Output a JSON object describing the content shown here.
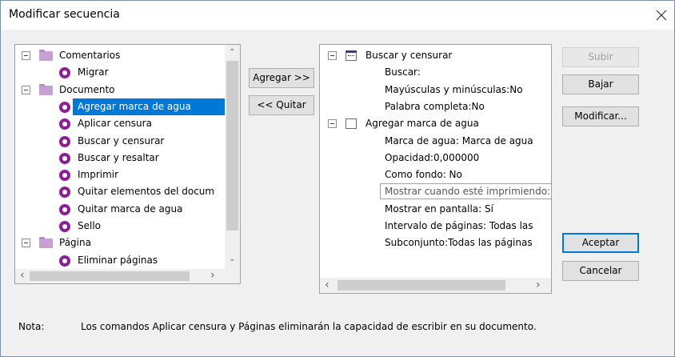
{
  "window": {
    "title": "Modificar secuencia"
  },
  "left_tree": [
    {
      "kind": "group",
      "label": "Comentarios"
    },
    {
      "kind": "item",
      "label": "Migrar"
    },
    {
      "kind": "group",
      "label": "Documento"
    },
    {
      "kind": "item",
      "label": "Agregar marca de agua",
      "selected": true
    },
    {
      "kind": "item",
      "label": "Aplicar censura"
    },
    {
      "kind": "item",
      "label": "Buscar y censurar"
    },
    {
      "kind": "item",
      "label": "Buscar y resaltar"
    },
    {
      "kind": "item",
      "label": "Imprimir"
    },
    {
      "kind": "item",
      "label": "Quitar elementos del docum"
    },
    {
      "kind": "item",
      "label": "Quitar marca de agua"
    },
    {
      "kind": "item",
      "label": "Sello"
    },
    {
      "kind": "group",
      "label": "Página"
    },
    {
      "kind": "item",
      "label": "Eliminar páginas"
    }
  ],
  "middle_buttons": {
    "add": "Agregar >>",
    "remove": "<< Quitar"
  },
  "right_tree": [
    {
      "kind": "group",
      "label": "Buscar y censurar",
      "icon": "dotted-rect-icon"
    },
    {
      "kind": "prop",
      "label": "Buscar:"
    },
    {
      "kind": "prop",
      "label": "Mayúsculas y minúsculas:No"
    },
    {
      "kind": "prop",
      "label": "Palabra completa:No"
    },
    {
      "kind": "group",
      "label": "Agregar marca de agua",
      "icon": "empty-rect-icon"
    },
    {
      "kind": "prop",
      "label": "Marca de agua: Marca de agua"
    },
    {
      "kind": "prop",
      "label": "Opacidad:0,000000"
    },
    {
      "kind": "prop",
      "label": "Como fondo: No"
    },
    {
      "kind": "prop",
      "label": "Mostrar cuando esté imprimiendo: Sí",
      "focused": true
    },
    {
      "kind": "prop",
      "label": "Mostrar en pantalla: Sí"
    },
    {
      "kind": "prop",
      "label": "Intervalo de páginas: Todas las"
    },
    {
      "kind": "prop",
      "label": "Subconjunto:Todas las páginas"
    }
  ],
  "side_buttons": {
    "up": "Subir",
    "down": "Bajar",
    "modify": "Modificar...",
    "ok": "Aceptar",
    "cancel": "Cancelar"
  },
  "note": {
    "label": "Nota:",
    "text": "Los comandos Aplicar censura y Páginas eliminarán la capacidad de escribir en su documento."
  },
  "colors": {
    "selection": "#0078d7",
    "bullet": "#8d1d98",
    "folder": "#c7a0d6"
  }
}
